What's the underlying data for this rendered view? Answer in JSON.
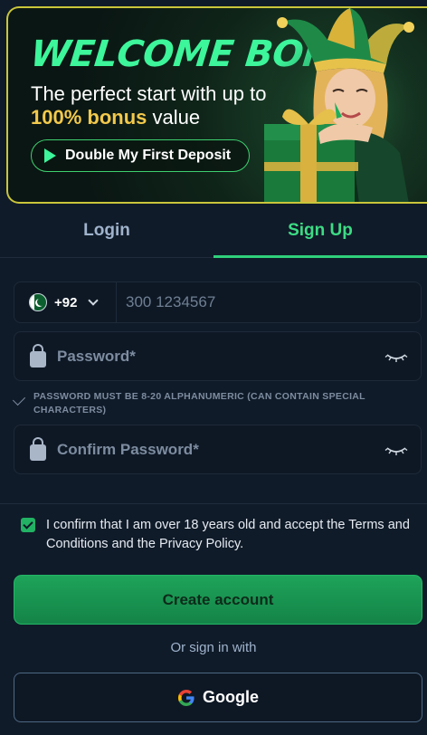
{
  "banner": {
    "title": "WELCOME BONUS",
    "line1": "The perfect start with up to",
    "highlight": "100% bonus",
    "line2_rest": " value",
    "cta_label": "Double My First Deposit",
    "border_color": "#c9c53b",
    "title_color": "#3df59a"
  },
  "tabs": {
    "login": "Login",
    "signup": "Sign Up",
    "active": "signup"
  },
  "phone": {
    "country_flag": "pakistan-flag-icon",
    "country_code": "+92",
    "placeholder": "300 1234567",
    "value": ""
  },
  "password": {
    "placeholder": "Password*",
    "value": ""
  },
  "password_hint": "PASSWORD MUST BE 8-20 ALPHANUMERIC (CAN CONTAIN SPECIAL CHARACTERS)",
  "confirm_password": {
    "placeholder": "Confirm Password*",
    "value": ""
  },
  "consent": {
    "checked": true,
    "text": "I confirm that I am over 18 years old and accept the Terms and Conditions and the Privacy Policy."
  },
  "create_account_label": "Create account",
  "or_sign_in_label": "Or sign in with",
  "google_label": "Google",
  "colors": {
    "background": "#101b29",
    "accent": "#2fd07a",
    "button": "#1ea35a"
  }
}
